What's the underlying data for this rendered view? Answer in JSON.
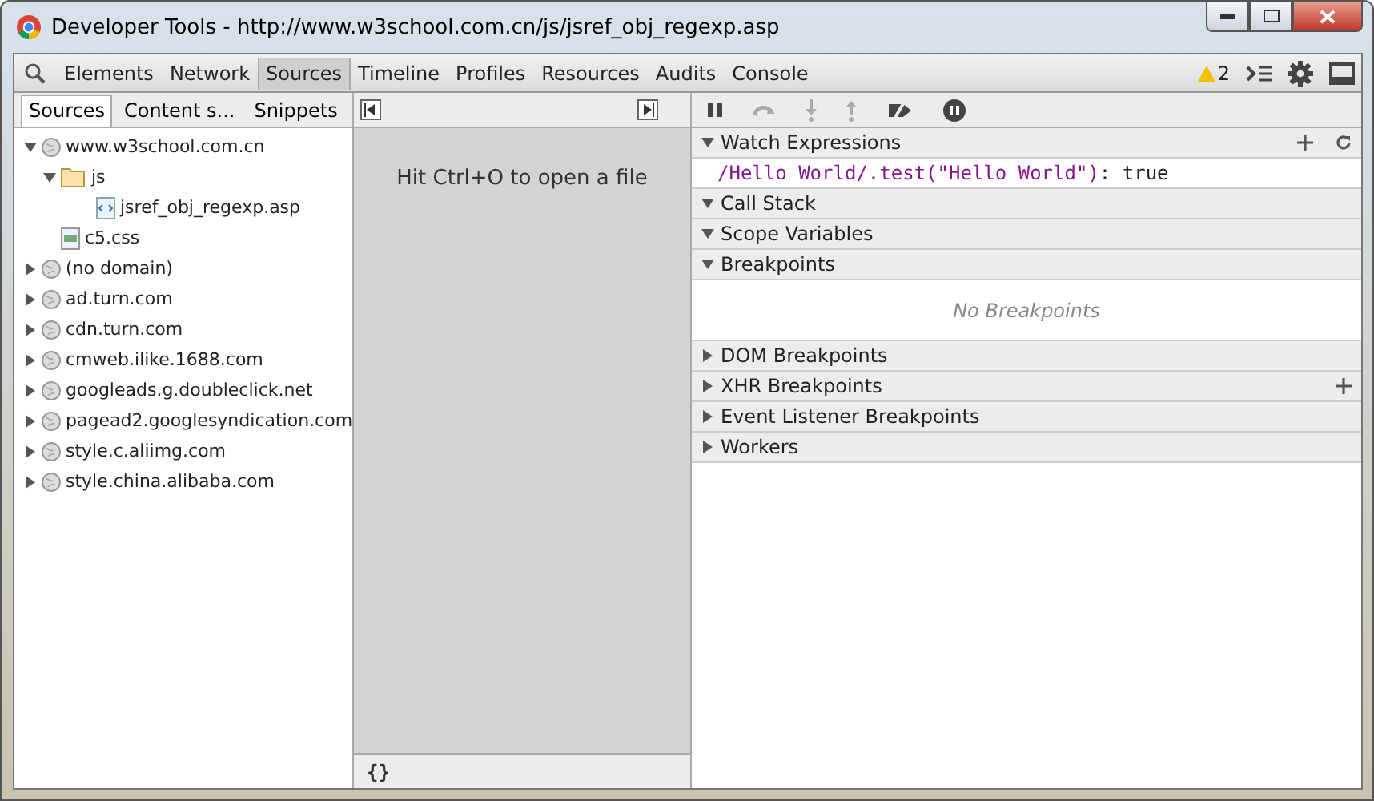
{
  "window": {
    "title": "Developer Tools - http://www.w3school.com.cn/js/jsref_obj_regexp.asp"
  },
  "toolbar": {
    "tabs": [
      {
        "label": "Elements",
        "selected": false
      },
      {
        "label": "Network",
        "selected": false
      },
      {
        "label": "Sources",
        "selected": true
      },
      {
        "label": "Timeline",
        "selected": false
      },
      {
        "label": "Profiles",
        "selected": false
      },
      {
        "label": "Resources",
        "selected": false
      },
      {
        "label": "Audits",
        "selected": false
      },
      {
        "label": "Console",
        "selected": false
      }
    ],
    "warning_count": "2"
  },
  "navigator": {
    "tabs": [
      {
        "label": "Sources",
        "selected": true
      },
      {
        "label": "Content s...",
        "selected": false
      },
      {
        "label": "Snippets",
        "selected": false
      }
    ],
    "tree": [
      {
        "label": "www.w3school.com.cn",
        "kind": "domain",
        "expanded": true,
        "children": [
          {
            "label": "js",
            "kind": "folder",
            "expanded": true,
            "children": [
              {
                "label": "jsref_obj_regexp.asp",
                "kind": "page"
              }
            ]
          },
          {
            "label": "c5.css",
            "kind": "stylesheet"
          }
        ]
      },
      {
        "label": "(no domain)",
        "kind": "domain",
        "expanded": false
      },
      {
        "label": "ad.turn.com",
        "kind": "domain",
        "expanded": false
      },
      {
        "label": "cdn.turn.com",
        "kind": "domain",
        "expanded": false
      },
      {
        "label": "cmweb.ilike.1688.com",
        "kind": "domain",
        "expanded": false
      },
      {
        "label": "googleads.g.doubleclick.net",
        "kind": "domain",
        "expanded": false
      },
      {
        "label": "pagead2.googlesyndication.com",
        "kind": "domain",
        "expanded": false
      },
      {
        "label": "style.c.aliimg.com",
        "kind": "domain",
        "expanded": false
      },
      {
        "label": "style.china.alibaba.com",
        "kind": "domain",
        "expanded": false
      }
    ]
  },
  "editor": {
    "hint": "Hit Ctrl+O to open a file",
    "footer_button": "{}"
  },
  "sidebar": {
    "sections": [
      {
        "title": "Watch Expressions",
        "expanded": true,
        "add_button": true,
        "refresh_button": true,
        "watch": {
          "expression": "/Hello World/.test(\"Hello World\")",
          "value": ": true"
        }
      },
      {
        "title": "Call Stack",
        "expanded": true
      },
      {
        "title": "Scope Variables",
        "expanded": true
      },
      {
        "title": "Breakpoints",
        "expanded": true,
        "empty_text": "No Breakpoints"
      },
      {
        "title": "DOM Breakpoints",
        "expanded": false
      },
      {
        "title": "XHR Breakpoints",
        "expanded": false,
        "add_button": true
      },
      {
        "title": "Event Listener Breakpoints",
        "expanded": false
      },
      {
        "title": "Workers",
        "expanded": false
      }
    ]
  }
}
